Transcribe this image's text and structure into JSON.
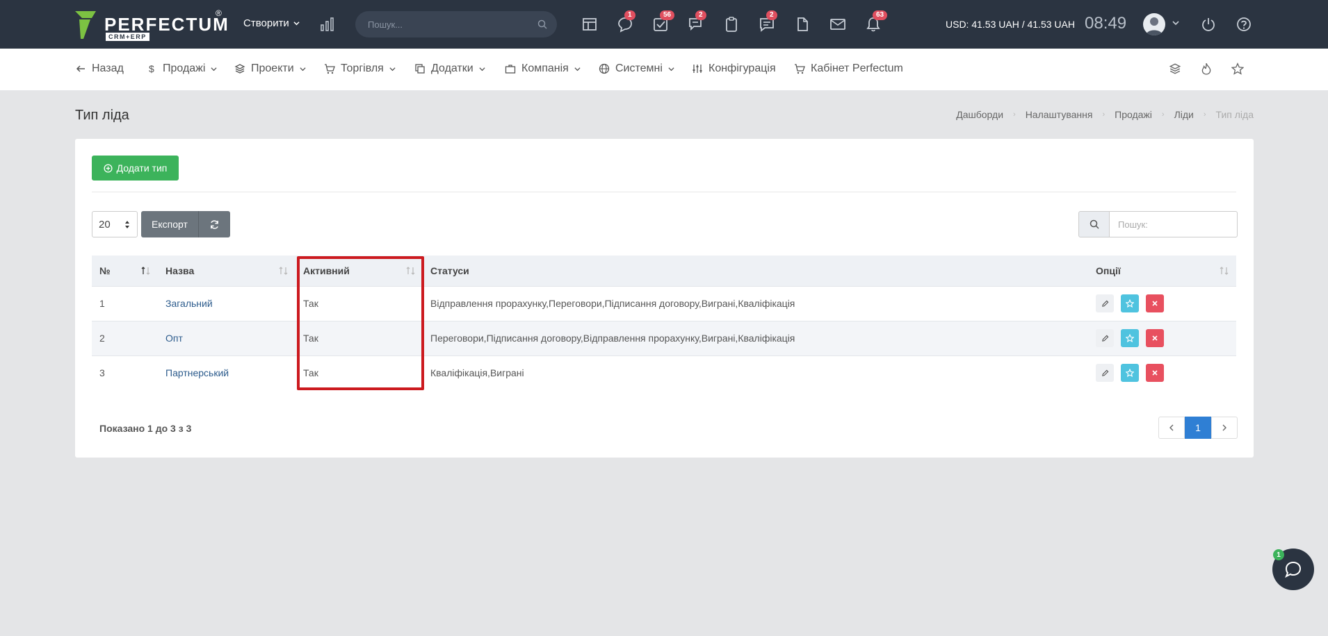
{
  "topbar": {
    "brand": "PERFECTUM",
    "brand_reg": "®",
    "brand_sub": "CRM+ERP",
    "create_label": "Створити",
    "search_placeholder": "Пошук...",
    "badges": {
      "chat": "1",
      "tasks": "56",
      "discussions": "2",
      "messages": "2",
      "notifications": "63"
    },
    "currency": "USD: 41.53 UAH / 41.53 UAH",
    "clock": "08:49"
  },
  "nav": {
    "back": "Назад",
    "sales": "Продажі",
    "projects": "Проекти",
    "trade": "Торгівля",
    "addons": "Додатки",
    "company": "Компанія",
    "system": "Системні",
    "config": "Конфігурація",
    "cabinet": "Кабінет Perfectum"
  },
  "page": {
    "title": "Тип ліда",
    "breadcrumb": [
      "Дашборди",
      "Налаштування",
      "Продажі",
      "Ліди",
      "Тип ліда"
    ]
  },
  "toolbar": {
    "add_label": "Додати тип",
    "page_length": "20",
    "export_label": "Експорт",
    "search_placeholder": "Пошук:"
  },
  "table": {
    "headers": [
      "№",
      "Назва",
      "Активний",
      "Статуси",
      "Опції"
    ],
    "rows": [
      {
        "num": "1",
        "name": "Загальний",
        "active": "Так",
        "statuses": "Відправлення прорахунку,Переговори,Підписання договору,Виграні,Кваліфікація"
      },
      {
        "num": "2",
        "name": "Опт",
        "active": "Так",
        "statuses": "Переговори,Підписання договору,Відправлення прорахунку,Виграні,Кваліфікація"
      },
      {
        "num": "3",
        "name": "Партнерський",
        "active": "Так",
        "statuses": "Кваліфікація,Виграні"
      }
    ],
    "info": "Показано 1 до 3 з 3",
    "current_page": "1"
  },
  "chat": {
    "badge": "1"
  },
  "colors": {
    "topbar": "#2b3441",
    "accent_green": "#3cb35b",
    "link_blue": "#2c5b8c",
    "page_active": "#2f7fd4",
    "highlight_red": "#cc1a1f"
  },
  "icons": [
    "chart-icon",
    "search-icon",
    "dashboard-icon",
    "chat-icon",
    "tasks-icon",
    "discussions-icon",
    "clipboard-icon",
    "messages-icon",
    "file-icon",
    "mail-icon",
    "bell-icon",
    "power-icon",
    "help-icon",
    "layers-icon",
    "fire-icon",
    "star-icon",
    "refresh-icon",
    "edit-icon",
    "close-icon"
  ]
}
